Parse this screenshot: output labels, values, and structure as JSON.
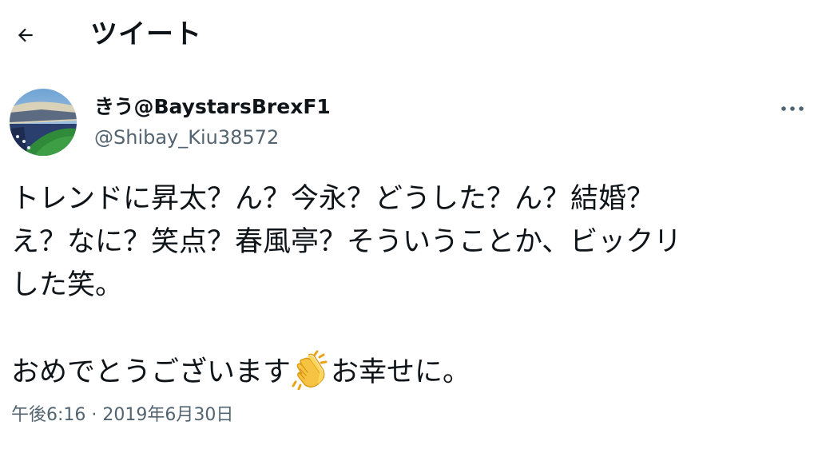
{
  "header": {
    "back_icon": "arrow-left-icon",
    "title": "ツイート"
  },
  "author": {
    "avatar_icon": "stadium-avatar",
    "display_name": "きう@BaystarsBrexF1",
    "handle": "@Shibay_Kiu38572",
    "more_icon": "more-horizontal-icon"
  },
  "tweet": {
    "lines": [
      "トレンドに昇太？ん？今永？どうした？ん？結婚？",
      "え？なに？笑点？春風亭？そういうことか、ビックリ",
      "した笑。"
    ],
    "congrats_before": "おめでとうございます",
    "emoji_icon": "clapping-hands-icon",
    "congrats_after": "お幸せに。"
  },
  "meta": {
    "time": "午後6:16",
    "separator": "·",
    "date": "2019年6月30日"
  },
  "colors": {
    "text_primary": "#0f1419",
    "text_secondary": "#536471",
    "background": "#ffffff"
  }
}
